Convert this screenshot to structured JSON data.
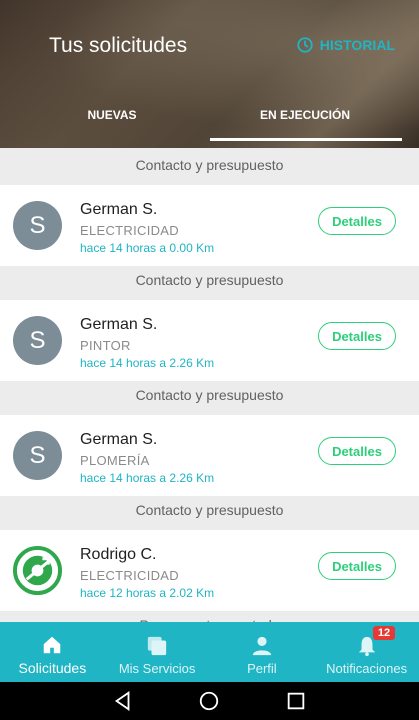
{
  "header": {
    "title": "Tus solicitudes",
    "historial_label": "HISTORIAL",
    "tabs": [
      "NUEVAS",
      "EN EJECUCIÓN"
    ],
    "active_tab": "EN EJECUCIÓN"
  },
  "colors": {
    "accent": "#1fb5c4",
    "button_green": "#2ecf7a",
    "avatar_grey": "#7c8d97",
    "badge_red": "#e53935"
  },
  "list": {
    "top_status": "Contacto y presupuesto",
    "items": [
      {
        "initial": "S",
        "name": "German S.",
        "category": "ELECTRICIDAD",
        "meta": "hace 14 horas a 0.00 Km",
        "button": "Detalles",
        "status": "Contacto y presupuesto"
      },
      {
        "initial": "S",
        "name": "German S.",
        "category": "PINTOR",
        "meta": "hace 14 horas a 2.26 Km",
        "button": "Detalles",
        "status": "Contacto y presupuesto"
      },
      {
        "initial": "S",
        "name": "German S.",
        "category": "PLOMERÍA",
        "meta": "hace 14 horas a 2.26 Km",
        "button": "Detalles",
        "status": "Contacto y presupuesto"
      },
      {
        "initial": "",
        "name": "Rodrigo C.",
        "category": "ELECTRICIDAD",
        "meta": "hace 12 horas a 2.02 Km",
        "button": "Detalles",
        "status": "Presupuesto aceptado",
        "avatar_icon": "green-circle-logo-icon"
      }
    ]
  },
  "bottom_nav": {
    "items": [
      {
        "label": "Solicitudes",
        "icon": "home-icon"
      },
      {
        "label": "Mis Servicios",
        "icon": "stack-icon"
      },
      {
        "label": "Perfil",
        "icon": "person-icon"
      },
      {
        "label": "Notificaciones",
        "icon": "bell-icon"
      }
    ],
    "notification_count": "12"
  }
}
